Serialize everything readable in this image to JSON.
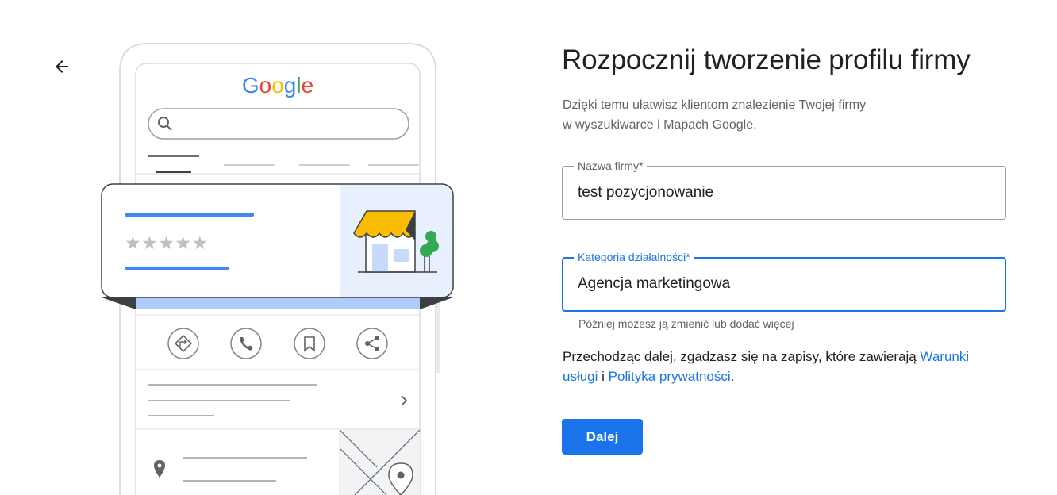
{
  "header": {
    "back_icon": "arrow-left-icon"
  },
  "illustration": {
    "logo_letters": [
      {
        "char": "G",
        "color": "#4285f4"
      },
      {
        "char": "o",
        "color": "#ea4335"
      },
      {
        "char": "o",
        "color": "#fbbc04"
      },
      {
        "char": "g",
        "color": "#4285f4"
      },
      {
        "char": "l",
        "color": "#34a853"
      },
      {
        "char": "e",
        "color": "#ea4335"
      }
    ],
    "rating_stars": "★★★★★",
    "action_icons": [
      "directions-icon",
      "phone-icon",
      "bookmark-icon",
      "share-icon"
    ],
    "colors": {
      "accent": "#4285f4",
      "awning": "#fbbc04",
      "tree": "#34a853",
      "store_bg": "#e8f0fe"
    }
  },
  "form": {
    "title": "Rozpocznij tworzenie profilu firmy",
    "subtitle_line1": "Dzięki temu ułatwisz klientom znalezienie Twojej firmy",
    "subtitle_line2": "w wyszukiwarce i Mapach Google.",
    "business_name": {
      "label": "Nazwa firmy*",
      "value": "test pozycjonowanie"
    },
    "category": {
      "label": "Kategoria działalności*",
      "value": "Agencja marketingowa"
    },
    "helper_text": "Później możesz ją zmienić lub dodać więcej",
    "terms": {
      "prefix": "Przechodząc dalej, zgadzasz się na zapisy, które zawierają ",
      "link_terms": "Warunki usługi",
      "conjunction": " i ",
      "link_privacy": "Polityka prywatności",
      "suffix": "."
    },
    "next_label": "Dalej",
    "primary_color": "#1a73e8"
  }
}
